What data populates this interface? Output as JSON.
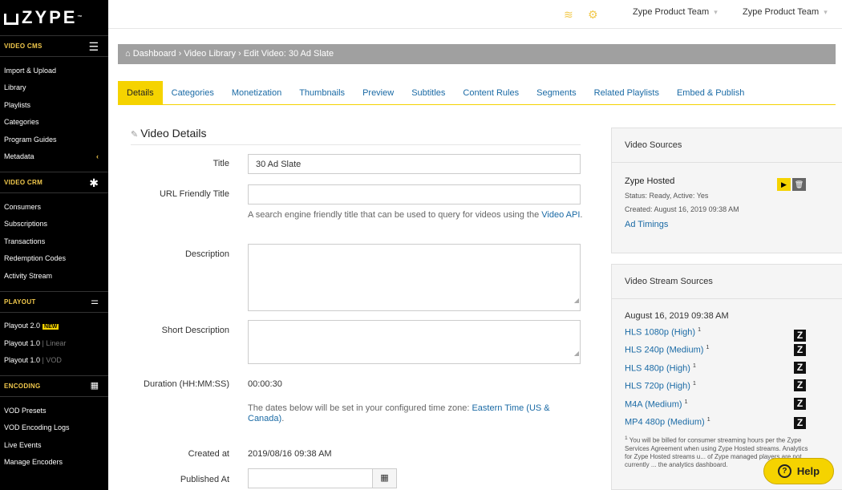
{
  "brand": {
    "logo": "ZYPE",
    "logo_mark": "™"
  },
  "sidebar": {
    "sections": [
      {
        "label": "VIDEO CMS",
        "icon": "menu-icon",
        "items": [
          {
            "label": "Import & Upload"
          },
          {
            "label": "Library"
          },
          {
            "label": "Playlists"
          },
          {
            "label": "Categories"
          },
          {
            "label": "Program Guides"
          },
          {
            "label": "Metadata"
          }
        ]
      },
      {
        "label": "VIDEO CRM",
        "icon": "asterisk-icon",
        "items": [
          {
            "label": "Consumers"
          },
          {
            "label": "Subscriptions"
          },
          {
            "label": "Transactions"
          },
          {
            "label": "Redemption Codes"
          },
          {
            "label": "Activity Stream"
          }
        ]
      },
      {
        "label": "PLAYOUT",
        "icon": "playout-icon",
        "items": [
          {
            "label": "Playout 2.0",
            "badge": "NEW"
          },
          {
            "label": "Playout 1.0",
            "sub": "| Linear"
          },
          {
            "label": "Playout 1.0",
            "sub": "| VOD"
          }
        ]
      },
      {
        "label": "ENCODING",
        "icon": "grid-icon",
        "items": [
          {
            "label": "VOD Presets"
          },
          {
            "label": "VOD Encoding Logs"
          },
          {
            "label": "Live Events"
          },
          {
            "label": "Manage Encoders"
          }
        ]
      }
    ]
  },
  "topbar": {
    "team_1": "Zype Product Team",
    "team_2": "Zype Product Team"
  },
  "breadcrumb": {
    "home": "Dashboard",
    "library": "Video Library",
    "current": "Edit Video: 30 Ad Slate"
  },
  "tabs": [
    "Details",
    "Categories",
    "Monetization",
    "Thumbnails",
    "Preview",
    "Subtitles",
    "Content Rules",
    "Segments",
    "Related Playlists",
    "Embed & Publish"
  ],
  "form": {
    "section_title": "Video Details",
    "title_label": "Title",
    "title_value": "30 Ad Slate",
    "url_label": "URL Friendly Title",
    "url_value": "",
    "url_help_text": "A search engine friendly title that can be used to query for videos using the ",
    "url_help_link": "Video API",
    "url_help_end": ".",
    "description_label": "Description",
    "description_value": "",
    "short_label": "Short Description",
    "short_value": "",
    "duration_label": "Duration (HH:MM:SS)",
    "duration_value": "00:00:30",
    "tz_text": "The dates below will be set in your configured time zone: ",
    "tz_link": "Eastern Time (US & Canada)",
    "tz_end": ".",
    "created_label": "Created at",
    "created_value": "2019/08/16 09:38 AM",
    "published_label": "Published At",
    "published_value": ""
  },
  "video_sources": {
    "title": "Video Sources",
    "source_name": "Zype Hosted",
    "status": "Status: Ready, Active: Yes",
    "created": "Created: August 16, 2019 09:38 AM",
    "ad_timings": "Ad Timings"
  },
  "stream_sources": {
    "title": "Video Stream Sources",
    "date": "August 16, 2019 09:38 AM",
    "streams": [
      "HLS 1080p (High)",
      "HLS 240p (Medium)",
      "HLS 480p (High)",
      "HLS 720p (High)",
      "M4A (Medium)",
      "MP4 480p (Medium)"
    ],
    "footnote_mark": "1",
    "footnote": "You will be billed for consumer streaming hours per the Zype Services Agreement when using Zype Hosted streams. Analytics for Zype Hosted streams u... of Zype managed players are not currently ... the analytics dashboard."
  },
  "help": {
    "label": "Help"
  }
}
